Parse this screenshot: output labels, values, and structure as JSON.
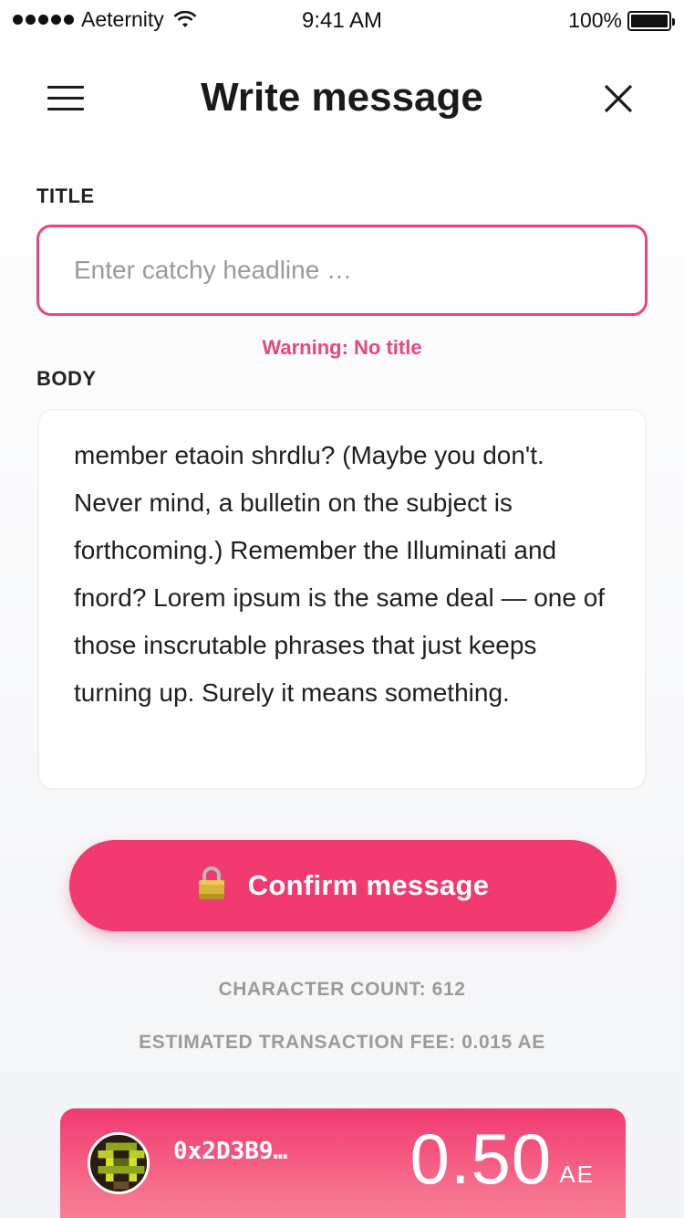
{
  "status_bar": {
    "carrier": "Aeternity",
    "time": "9:41 AM",
    "battery": "100%"
  },
  "header": {
    "title": "Write message"
  },
  "form": {
    "title_label": "TITLE",
    "title_placeholder": "Enter catchy headline …",
    "title_value": "",
    "warning": "Warning: No title",
    "body_label": "BODY",
    "body_text": "member etaoin shrdlu? (Maybe you don't. Never mind, a bulletin on the subject is forthcoming.) Remember the Illuminati and fnord? Lorem ipsum is the same deal — one of those inscrutable phrases that just keeps turning up. Surely it means something."
  },
  "actions": {
    "confirm_label": "Confirm message"
  },
  "info": {
    "character_count": "CHARACTER COUNT: 612",
    "transaction_fee": "ESTIMATED TRANSACTION FEE: 0.015 AE"
  },
  "wallet": {
    "address": "0x2D3B9…",
    "balance": "0.50",
    "unit": "AE"
  },
  "icons": {
    "menu": "hamburger-menu-icon",
    "close": "close-icon",
    "lock": "lock-icon",
    "wifi": "wifi-icon",
    "battery": "battery-icon"
  },
  "colors": {
    "accent": "#f03a70",
    "warning": "#e8467c"
  }
}
